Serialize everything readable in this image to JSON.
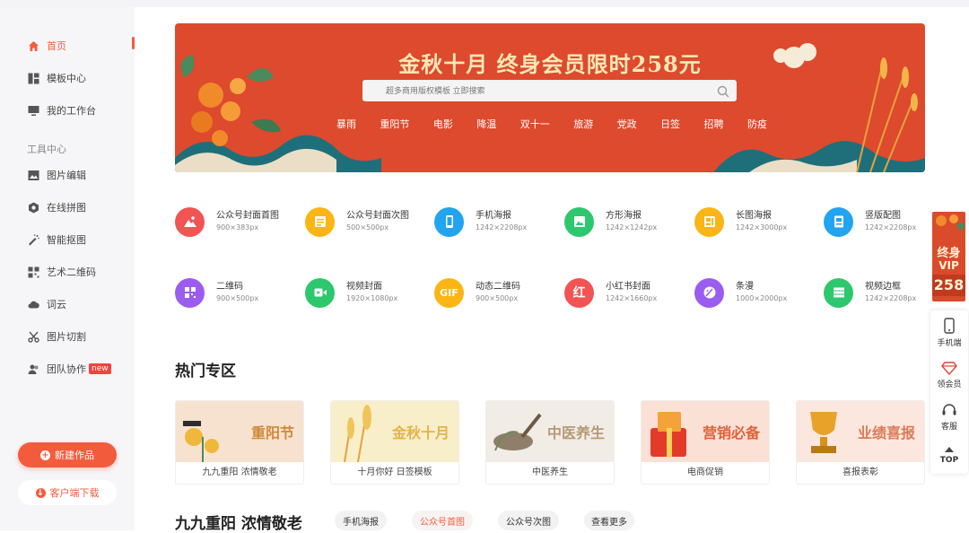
{
  "sidebar": {
    "items": [
      {
        "label": "首页",
        "icon": "home-icon"
      },
      {
        "label": "模板中心",
        "icon": "grid-icon"
      },
      {
        "label": "我的工作台",
        "icon": "monitor-icon"
      }
    ],
    "tools_label": "工具中心",
    "tools": [
      {
        "label": "图片编辑",
        "icon": "image-icon"
      },
      {
        "label": "在线拼图",
        "icon": "hexagon-icon"
      },
      {
        "label": "智能抠图",
        "icon": "magic-wand-icon"
      },
      {
        "label": "艺术二维码",
        "icon": "qrcode-icon"
      },
      {
        "label": "词云",
        "icon": "cloud-icon"
      },
      {
        "label": "图片切割",
        "icon": "scissors-icon"
      },
      {
        "label": "团队协作",
        "icon": "team-icon",
        "badge": "new"
      }
    ],
    "new_button": "新建作品",
    "download_button": "客户端下载"
  },
  "banner": {
    "title": "金秋十月 终身会员限时258元",
    "search_placeholder": "超多商用版权模板 立即搜索",
    "tags": [
      "暴雨",
      "重阳节",
      "电影",
      "降温",
      "双十一",
      "旅游",
      "党政",
      "日签",
      "招聘",
      "防疫"
    ]
  },
  "categories": [
    {
      "name": "公众号封面首图",
      "size": "900×383px",
      "color": "#f25353",
      "icon": "mountain-icon"
    },
    {
      "name": "公众号封面次图",
      "size": "500×500px",
      "color": "#fbb514",
      "icon": "list-icon"
    },
    {
      "name": "手机海报",
      "size": "1242×2208px",
      "color": "#22a4f0",
      "icon": "phone-icon"
    },
    {
      "name": "方形海报",
      "size": "1242×1242px",
      "color": "#2dc76d",
      "icon": "picture-icon"
    },
    {
      "name": "长图海报",
      "size": "1242×3000px",
      "color": "#fbb514",
      "icon": "longimage-icon"
    },
    {
      "name": "竖版配图",
      "size": "1242×2208px",
      "color": "#22a4f0",
      "icon": "vertical-image-icon"
    },
    {
      "name": "二维码",
      "size": "900×500px",
      "color": "#9b5cf0",
      "icon": "qrcode-icon"
    },
    {
      "name": "视频封面",
      "size": "1920×1080px",
      "color": "#2dc76d",
      "icon": "video-icon"
    },
    {
      "name": "动态二维码",
      "size": "900×500px",
      "color": "#fbb514",
      "icon": "gif-icon",
      "glyph": "GIF"
    },
    {
      "name": "小红书封面",
      "size": "1242×1660px",
      "color": "#f25353",
      "icon": "xiaohongshu-icon",
      "glyph": "红"
    },
    {
      "name": "条漫",
      "size": "1000×2000px",
      "color": "#9b5cf0",
      "icon": "palette-icon"
    },
    {
      "name": "视频边框",
      "size": "1242×2208px",
      "color": "#2dc76d",
      "icon": "frame-icon"
    }
  ],
  "hot": {
    "title": "热门专区",
    "cards": [
      {
        "img_text": "重阳节",
        "caption": "九九重阳 浓情敬老",
        "bg": "#f7e2cf",
        "color": "#d2873a"
      },
      {
        "img_text": "金秋十月",
        "caption": "十月你好 日签模板",
        "bg": "#f8eec9",
        "color": "#e4b24a"
      },
      {
        "img_text": "中医养生",
        "caption": "中医养生",
        "bg": "#f1ece6",
        "color": "#b59a77"
      },
      {
        "img_text": "营销必备",
        "caption": "电商促销",
        "bg": "#fbe0d6",
        "color": "#e0623a"
      },
      {
        "img_text": "业绩喜报",
        "caption": "喜报表彰",
        "bg": "#fbe7de",
        "color": "#dd7a58"
      }
    ]
  },
  "section2": {
    "title": "九九重阳 浓情敬老",
    "pills": [
      "手机海报",
      "公众号首图",
      "公众号次图",
      "查看更多"
    ]
  },
  "vip": {
    "line1": "终身",
    "line2": "VIP",
    "price": "258"
  },
  "side_tools": [
    {
      "label": "手机端",
      "icon": "mobile-icon"
    },
    {
      "label": "领会员",
      "icon": "diamond-icon"
    },
    {
      "label": "客服",
      "icon": "headset-icon"
    },
    {
      "label": "TOP",
      "icon": "arrow-up-icon"
    }
  ]
}
